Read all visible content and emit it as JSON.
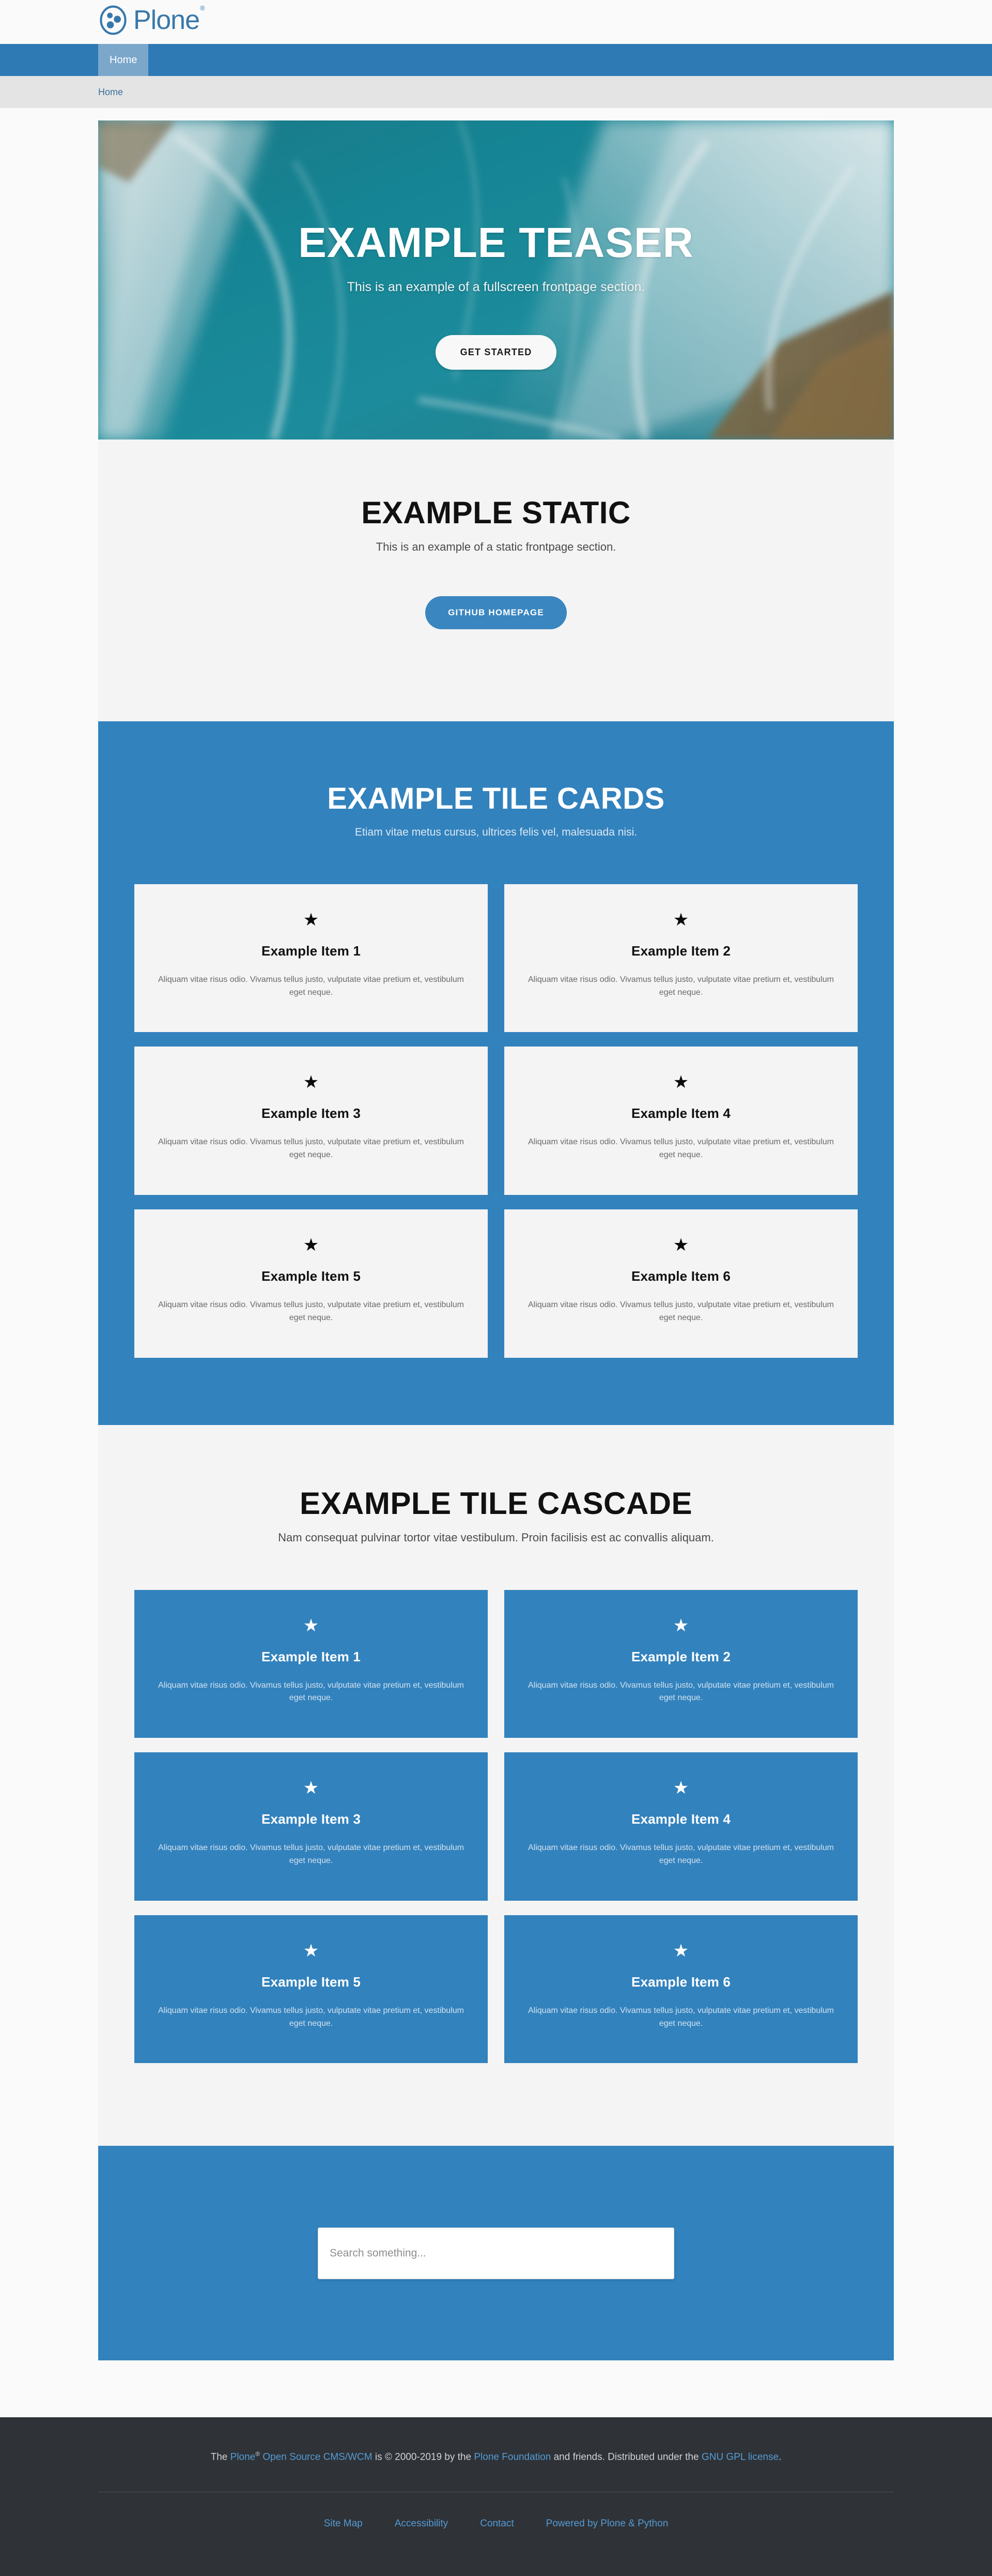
{
  "header": {
    "logo_text": "Plone",
    "logo_registered": "®",
    "logo_icon": "plone-logo-icon"
  },
  "nav": {
    "items": [
      {
        "label": "Home",
        "active": true
      }
    ]
  },
  "breadcrumb": {
    "items": [
      {
        "label": "Home"
      }
    ]
  },
  "hero": {
    "title": "EXAMPLE TEASER",
    "subtitle": "This is an example of a fullscreen frontpage section.",
    "button_label": "GET STARTED",
    "background_image": "ocean-waves-aerial-photo"
  },
  "static_section": {
    "title": "EXAMPLE STATIC",
    "subtitle": "This is an example of a static frontpage section.",
    "button_label": "GITHUB HOMEPAGE"
  },
  "tile_cards_section": {
    "title": "EXAMPLE TILE CARDS",
    "subtitle": "Etiam vitae metus cursus, ultrices felis vel, malesuada nisi.",
    "tiles": [
      {
        "icon": "star-icon",
        "title": "Example Item 1",
        "desc": "Aliquam vitae risus odio. Vivamus tellus justo, vulputate vitae pretium et, vestibulum eget neque."
      },
      {
        "icon": "star-icon",
        "title": "Example Item 2",
        "desc": "Aliquam vitae risus odio. Vivamus tellus justo, vulputate vitae pretium et, vestibulum eget neque."
      },
      {
        "icon": "star-icon",
        "title": "Example Item 3",
        "desc": "Aliquam vitae risus odio. Vivamus tellus justo, vulputate vitae pretium et, vestibulum eget neque."
      },
      {
        "icon": "star-icon",
        "title": "Example Item 4",
        "desc": "Aliquam vitae risus odio. Vivamus tellus justo, vulputate vitae pretium et, vestibulum eget neque."
      },
      {
        "icon": "star-icon",
        "title": "Example Item 5",
        "desc": "Aliquam vitae risus odio. Vivamus tellus justo, vulputate vitae pretium et, vestibulum eget neque."
      },
      {
        "icon": "star-icon",
        "title": "Example Item 6",
        "desc": "Aliquam vitae risus odio. Vivamus tellus justo, vulputate vitae pretium et, vestibulum eget neque."
      }
    ]
  },
  "tile_cascade_section": {
    "title": "EXAMPLE TILE CASCADE",
    "subtitle": "Nam consequat pulvinar tortor vitae vestibulum. Proin facilisis est ac convallis aliquam.",
    "tiles": [
      {
        "icon": "star-icon",
        "title": "Example Item 1",
        "desc": "Aliquam vitae risus odio. Vivamus tellus justo, vulputate vitae pretium et, vestibulum eget neque."
      },
      {
        "icon": "star-icon",
        "title": "Example Item 2",
        "desc": "Aliquam vitae risus odio. Vivamus tellus justo, vulputate vitae pretium et, vestibulum eget neque."
      },
      {
        "icon": "star-icon",
        "title": "Example Item 3",
        "desc": "Aliquam vitae risus odio. Vivamus tellus justo, vulputate vitae pretium et, vestibulum eget neque."
      },
      {
        "icon": "star-icon",
        "title": "Example Item 4",
        "desc": "Aliquam vitae risus odio. Vivamus tellus justo, vulputate vitae pretium et, vestibulum eget neque."
      },
      {
        "icon": "star-icon",
        "title": "Example Item 5",
        "desc": "Aliquam vitae risus odio. Vivamus tellus justo, vulputate vitae pretium et, vestibulum eget neque."
      },
      {
        "icon": "star-icon",
        "title": "Example Item 6",
        "desc": "Aliquam vitae risus odio. Vivamus tellus justo, vulputate vitae pretium et, vestibulum eget neque."
      }
    ]
  },
  "search_section": {
    "placeholder": "Search something...",
    "value": ""
  },
  "footer": {
    "colophon": {
      "part1": "The ",
      "link_plone": "Plone",
      "registered": "®",
      "link_oss": " Open Source CMS/WCM",
      "part2": " is © 2000-2019 by the ",
      "link_foundation": "Plone Foundation",
      "part3": " and friends. Distributed under the ",
      "link_license": "GNU GPL license",
      "part4": "."
    },
    "links": [
      {
        "label": "Site Map"
      },
      {
        "label": "Accessibility"
      },
      {
        "label": "Contact"
      },
      {
        "label": "Powered by Plone & Python"
      }
    ]
  },
  "colors": {
    "brand_blue": "#3282bd",
    "nav_blue": "#2e7ab5",
    "nav_active": "#7ba7cb",
    "breadcrumb_bg": "#e4e4e4",
    "page_bg": "#fafafa",
    "section_light": "#f4f4f4",
    "footer_bg": "#2f3236",
    "link_blue": "#539bd6",
    "logo_blue": "#3778ab"
  }
}
